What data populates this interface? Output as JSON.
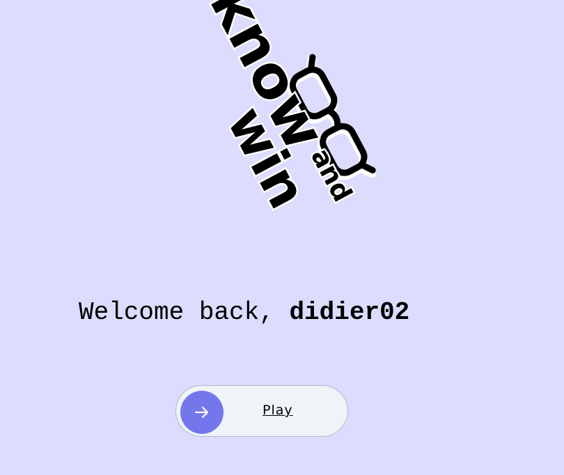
{
  "logo": {
    "word_know": "know",
    "word_and": "and",
    "word_win": "win",
    "icon": "glasses-icon"
  },
  "welcome": {
    "greeting": "Welcome back, ",
    "username": "didier02"
  },
  "play": {
    "label": "Play",
    "icon": "arrow-right-icon"
  },
  "colors": {
    "background": "#dcdcfe",
    "button_background": "#eef4f7",
    "accent": "#7477ec"
  }
}
